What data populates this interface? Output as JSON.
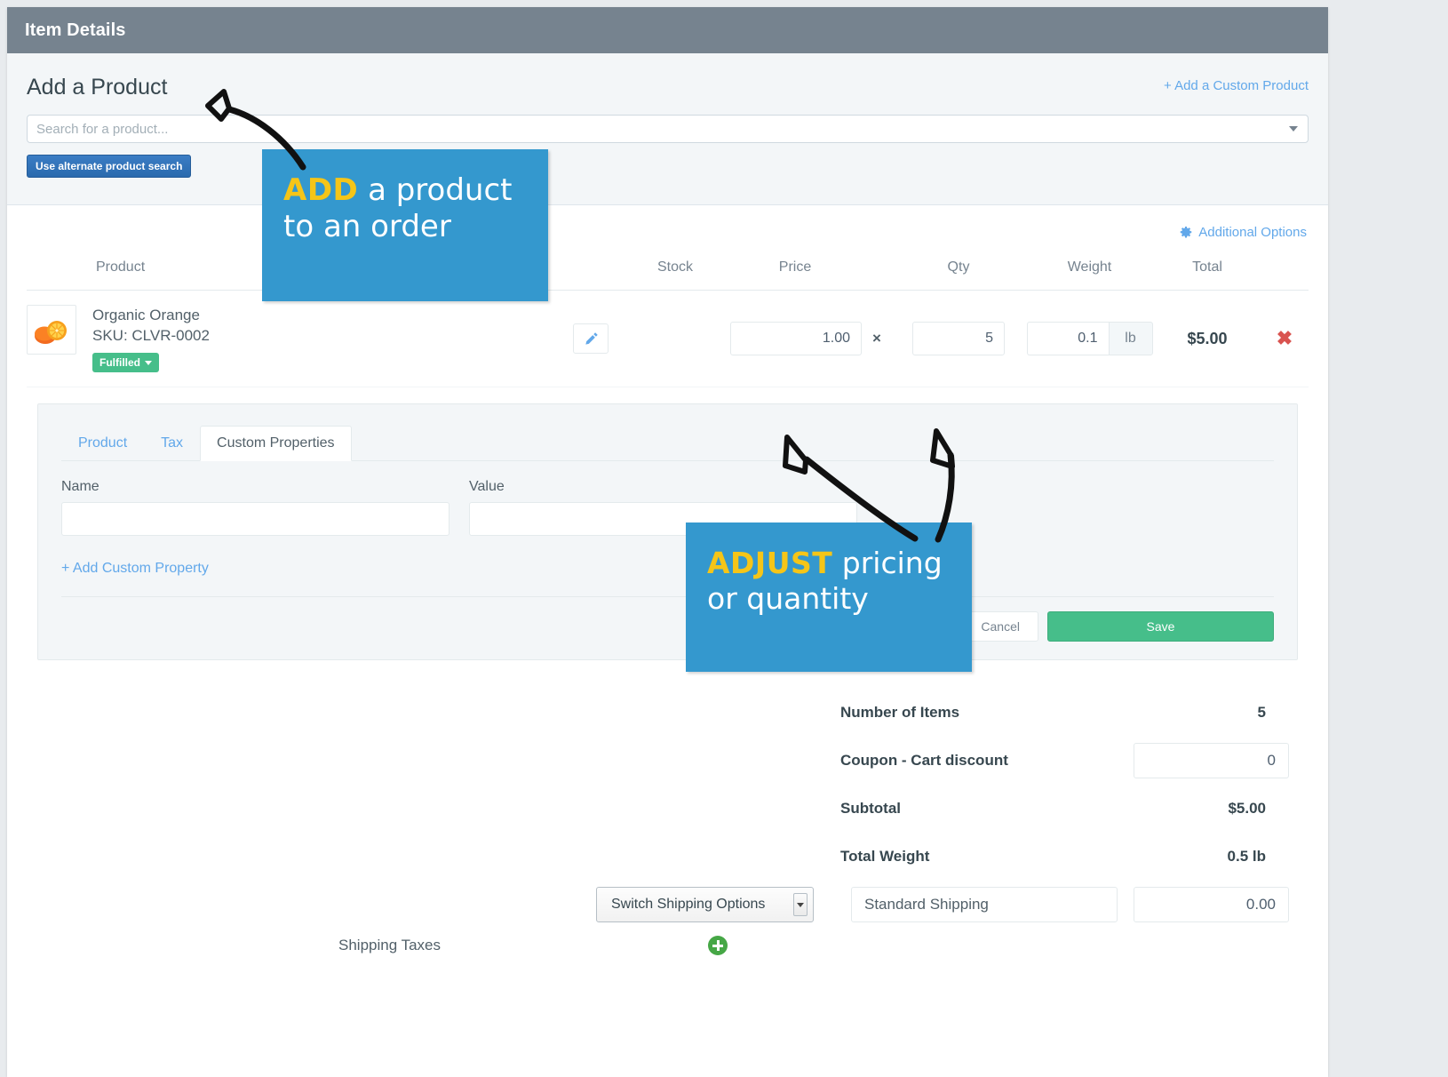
{
  "window": {
    "title": "Item Details"
  },
  "add_product": {
    "heading": "Add a Product",
    "custom_product_link": "+ Add a Custom Product",
    "search_placeholder": "Search for a product...",
    "search_value": "",
    "alt_search_button": "Use alternate product search"
  },
  "items_panel": {
    "additional_options": "Additional Options",
    "gear_icon": "gear-icon",
    "columns": {
      "product": "Product",
      "stock": "Stock",
      "price": "Price",
      "qty": "Qty",
      "weight": "Weight",
      "total": "Total"
    },
    "multiply_symbol": "×",
    "delete_symbol": "✖",
    "rows": [
      {
        "name": "Organic Orange",
        "sku": "SKU: CLVR-0002",
        "status_badge": "Fulfilled",
        "stock": "",
        "price": "1.00",
        "qty": "5",
        "weight": "0.1",
        "weight_unit": "lb",
        "total": "$5.00",
        "thumbnail_icon": "orange-fruit-image",
        "edit_icon": "pencil-icon"
      }
    ]
  },
  "detail_card": {
    "tabs": [
      {
        "label": "Product",
        "active": false
      },
      {
        "label": "Tax",
        "active": false
      },
      {
        "label": "Custom Properties",
        "active": true
      }
    ],
    "name_label": "Name",
    "name_value": "",
    "value_label": "Value",
    "value_value": "",
    "add_property_link": "+ Add Custom Property",
    "cancel_button": "Cancel",
    "save_button": "Save"
  },
  "summary": {
    "number_of_items_label": "Number of Items",
    "number_of_items_value": "5",
    "coupon_label": "Coupon - Cart discount",
    "coupon_value": "0",
    "subtotal_label": "Subtotal",
    "subtotal_value": "$5.00",
    "total_weight_label": "Total Weight",
    "total_weight_value": "0.5 lb",
    "switch_shipping_options": "Switch Shipping Options",
    "shipping_name": "Standard Shipping",
    "shipping_amount": "0.00",
    "shipping_taxes_label": "Shipping Taxes",
    "add_tax_icon": "plus-circle-icon"
  },
  "annotations": [
    {
      "id": "add",
      "keyword": "ADD",
      "line1_rest": " a product",
      "line2": "to an order"
    },
    {
      "id": "adjust",
      "keyword": "ADJUST",
      "line1_rest": " pricing",
      "line2": "or quantity"
    }
  ],
  "colors": {
    "titlebar": "#76838f",
    "link": "#62a8ea",
    "callout": "#3498ce",
    "callout_keyword": "#f5c518",
    "save_green": "#46be8a",
    "badge_green": "#46be8a",
    "delete_red": "#d9534f",
    "alt_button_blue": "#2b6cb0"
  }
}
